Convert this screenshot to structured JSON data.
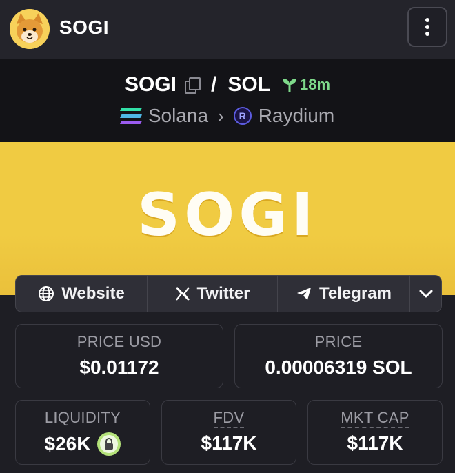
{
  "header": {
    "app_title": "SOGI",
    "avatar_icon": "shiba-dog-avatar",
    "menu_icon": "vertical-dots-icon"
  },
  "pair": {
    "base": "SOGI",
    "separator": "/",
    "quote": "SOL",
    "age": "18m",
    "chain": "Solana",
    "dex": "Raydium",
    "chain_colors": [
      "#9b5cf0",
      "#4fb8e6",
      "#32e0a8"
    ],
    "age_color": "#7ed98a"
  },
  "banner": {
    "text": "SOGI",
    "background": "#f0cb42"
  },
  "links": {
    "website": "Website",
    "twitter": "Twitter",
    "telegram": "Telegram"
  },
  "stats": {
    "price_usd_label": "PRICE USD",
    "price_usd_value": "$0.01172",
    "price_label": "PRICE",
    "price_value": "0.00006319 SOL",
    "liquidity_label": "LIQUIDITY",
    "liquidity_value": "$26K",
    "fdv_label": "FDV",
    "fdv_value": "$117K",
    "mktcap_label": "MKT CAP",
    "mktcap_value": "$117K"
  }
}
